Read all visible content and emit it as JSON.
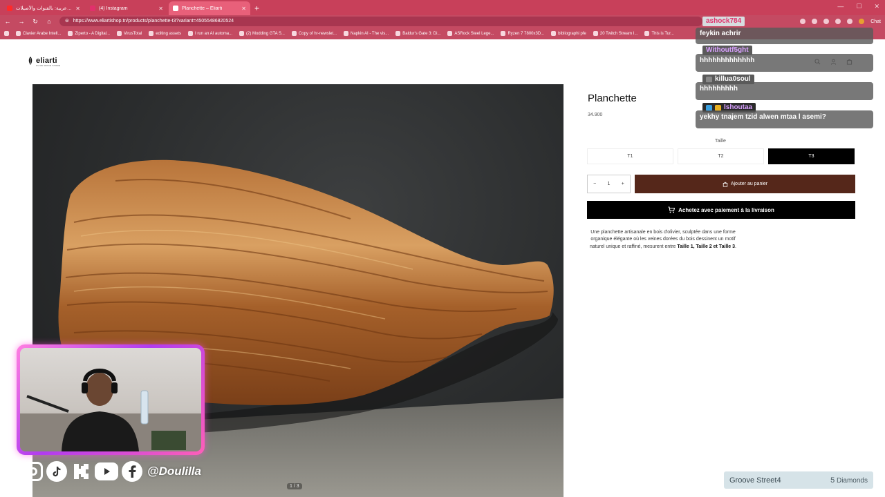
{
  "browser": {
    "tabs": [
      {
        "title": "نادي عربية: بالقنوات والأصيلات ...",
        "active": false,
        "fav_color": "#ff2a2a"
      },
      {
        "title": "(4) Instagram",
        "active": false,
        "fav_color": "#e1306c"
      },
      {
        "title": "Planchette – Eliarti",
        "active": true,
        "fav_color": "#ffffff"
      }
    ],
    "url": "https://www.eliartishop.tn/products/planchette-t3?variant=45055486820524",
    "chat_label": "Chat",
    "bookmarks": [
      "Clavier Arabe Intell...",
      "Ziperto - A Digital...",
      "VirusTotal",
      "editing assets",
      "I run an AI automa...",
      "(2) Modding GTA S...",
      "Copy of hr-newslet...",
      "Napkin AI - The vis...",
      "Baldur's Gate 3: Di...",
      "ASRock Steel Lege...",
      "Ryzen 7 7800x3D...",
      "bibliographi pfe",
      "20 Twitch Stream I...",
      "This is Tur..."
    ]
  },
  "store": {
    "logo_text": "eliarti",
    "logo_sub": "OLIVE WOOD STORE",
    "product_title": "Planchette",
    "price": "34.900",
    "size_label": "Taille",
    "sizes": [
      "T1",
      "T2",
      "T3"
    ],
    "selected_size": "T3",
    "qty_minus": "−",
    "qty_value": "1",
    "qty_plus": "+",
    "add_to_cart": "Ajouter au panier",
    "cod_button": "Achetez avec paiement à la livraison",
    "description_main": "Une planchette artisanale en bois d'olivier, sculptée dans une forme organique élégante où les veines dorées du bois dessinent un motif naturel unique et raffiné, mesurent entre",
    "description_sizes": "Taille 1, Taille 2 et Taille 3",
    "description_end": ".",
    "image_counter": "1 / 3"
  },
  "stream": {
    "chat": [
      {
        "user": "ashock784",
        "message": "",
        "name_bg": "#d7dde0",
        "name_color": "#e0306a"
      },
      {
        "user": "feykin achrir",
        "message": "",
        "name_bg": "#5a5a5a",
        "name_color": "#ffffff"
      },
      {
        "user": "Withoutf5ght",
        "message": "hhhhhhhhhhhhh",
        "name_bg": "#5a5a5a",
        "name_color": "#d9a0ff"
      },
      {
        "user": "killua0soul",
        "message": "hhhhhhhhh",
        "name_bg": "#5a5a5a",
        "name_color": "#ffffff"
      },
      {
        "user": "Ishoutaa",
        "message": "yekhy tnajem tzid alwen mtaa l asemi?",
        "name_bg": "#2b2b2b",
        "name_color": "#d9a0ff"
      }
    ],
    "handle": "@Doulilla",
    "alert_name": "Groove Street4",
    "alert_amount": "5",
    "alert_unit": "Diamonds"
  },
  "colors": {
    "browser_bar": "#c8405a",
    "add_to_cart_bg": "#55271a",
    "cod_bg": "#000000",
    "webcam_border": "#d13cf0"
  }
}
